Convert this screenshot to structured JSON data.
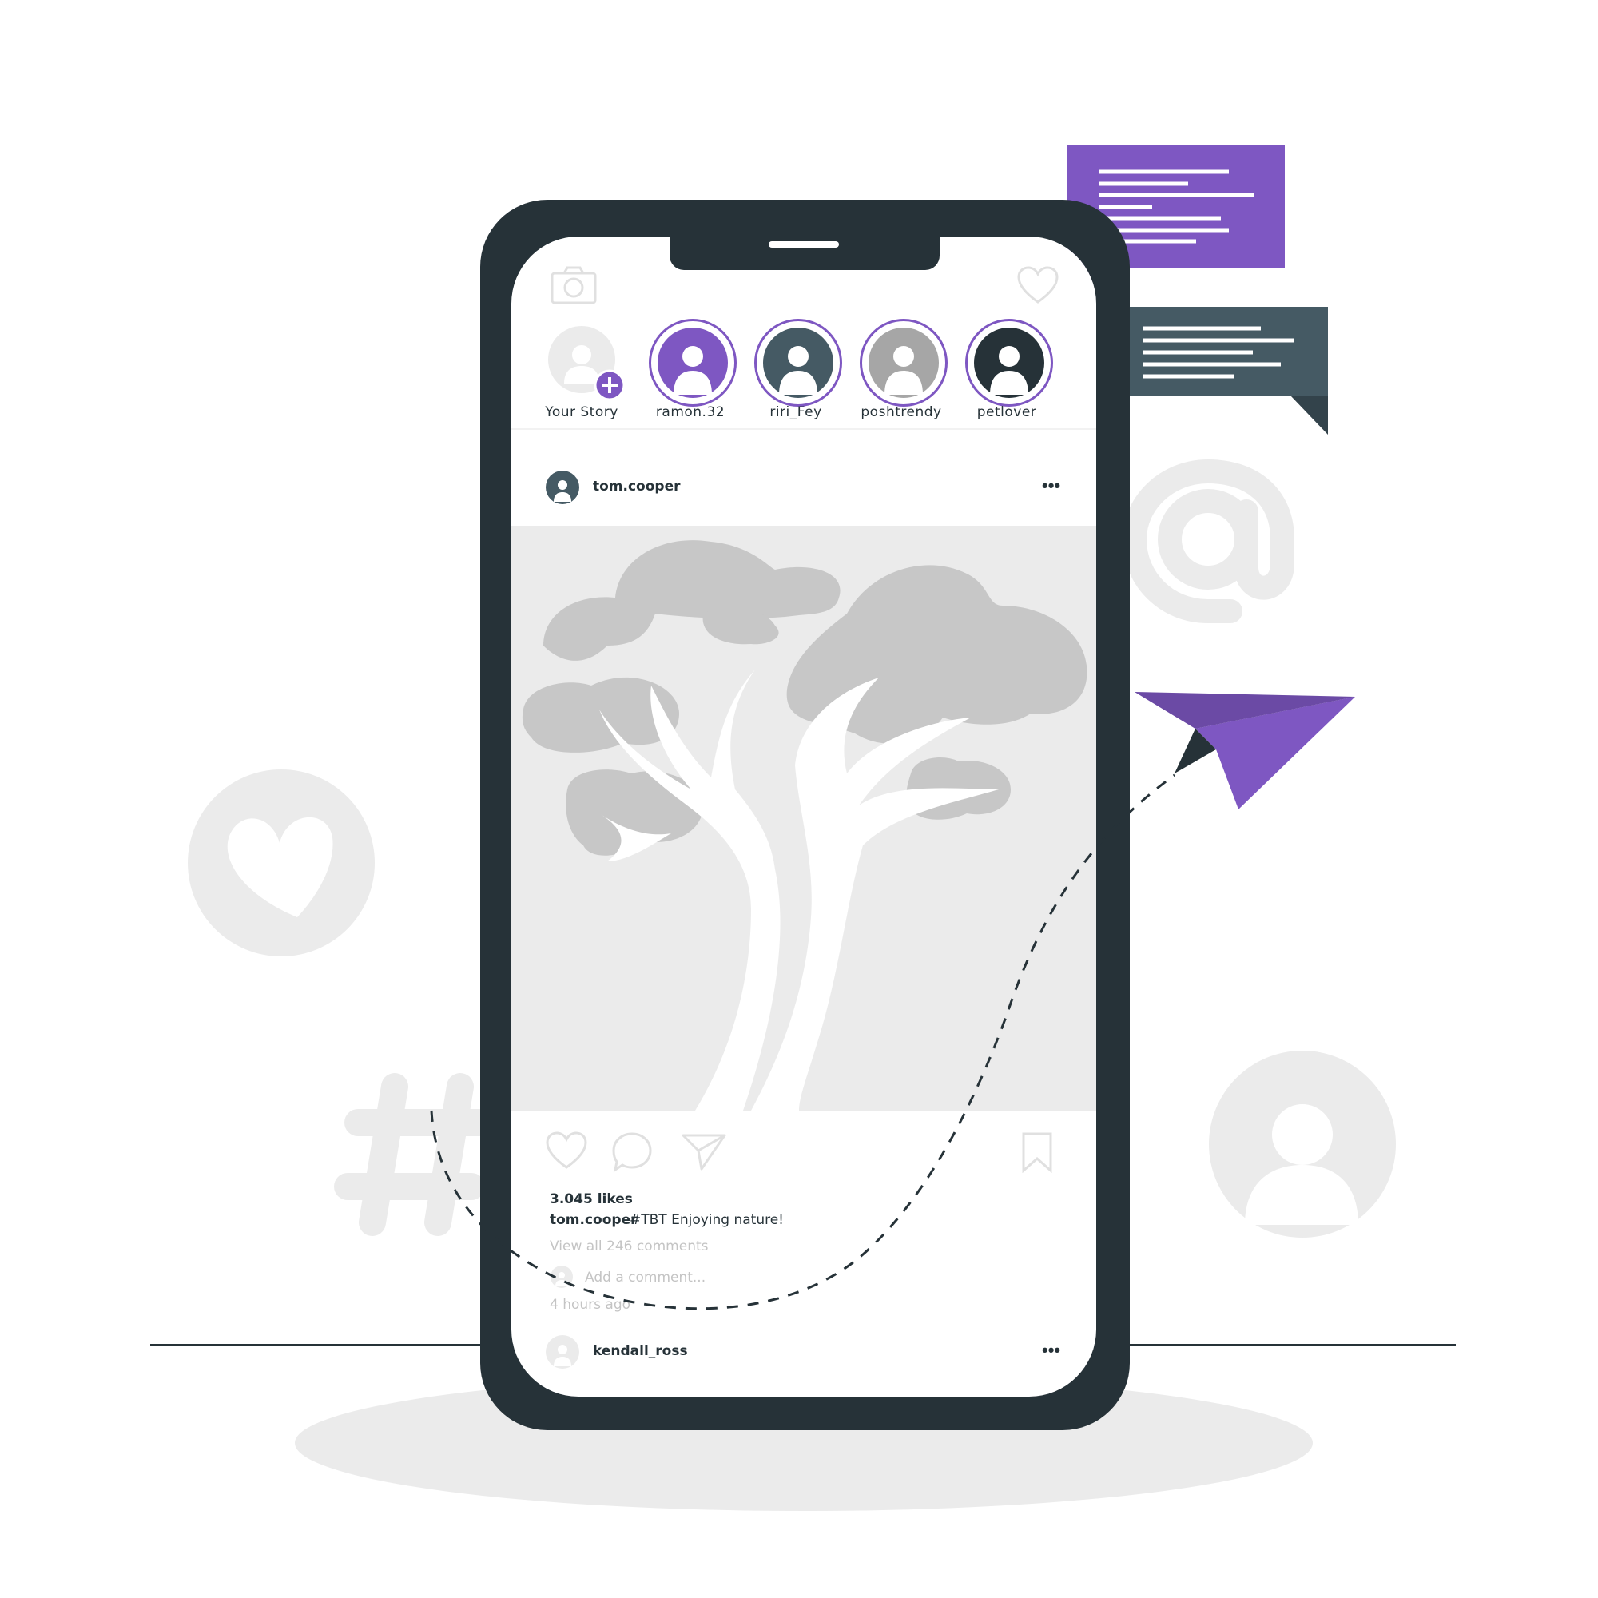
{
  "colors": {
    "accent": "#7e57c2",
    "dark": "#263238",
    "slate": "#455a64",
    "light_gray": "#ebebeb",
    "mid_gray": "#c7c7c7"
  },
  "stories": [
    {
      "label": "Your Story",
      "style": "add",
      "icon": "add-icon"
    },
    {
      "label": "ramon.32",
      "style": "purple"
    },
    {
      "label": "riri_Fey",
      "style": "slate"
    },
    {
      "label": "poshtrendy",
      "style": "gray"
    },
    {
      "label": "petlover",
      "style": "dark"
    }
  ],
  "post": {
    "username": "tom.cooper",
    "more_label": "•••",
    "likes": "3.045 likes",
    "caption_user": "tom.cooper",
    "caption_text": "#TBT  Enjoying nature!",
    "view_comments": "View all 246 comments",
    "add_comment_placeholder": "Add a comment...",
    "time_ago": "4 hours ago"
  },
  "next_post": {
    "username": "kendall_ross",
    "more_label": "•••"
  },
  "icons": {
    "camera": "camera-icon",
    "activity": "heart-outline-icon",
    "like": "heart-outline-icon",
    "comment": "comment-icon",
    "share": "paper-plane-icon",
    "save": "bookmark-icon",
    "at": "at-sign-icon",
    "hashtag": "hashtag-icon",
    "heart_badge": "heart-icon",
    "user_badge": "user-icon",
    "paper_plane": "paper-plane-icon"
  }
}
